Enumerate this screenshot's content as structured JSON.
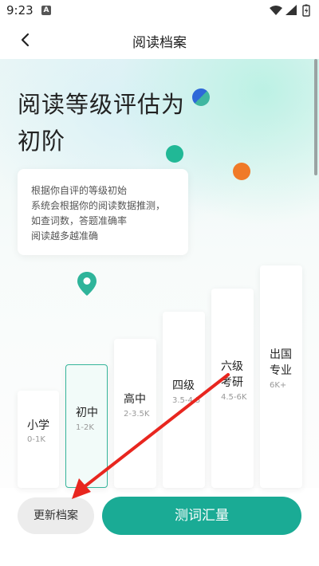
{
  "status_bar": {
    "time": "9:23",
    "notification_letter": "A"
  },
  "header": {
    "title": "阅读档案"
  },
  "main": {
    "headline_lines": [
      "阅读等级评估为",
      "初阶"
    ],
    "info_lines": [
      "根据你自评的等级初始",
      "系统会根据你的阅读数据推测，",
      "如查词数，答题准确率",
      "阅读越多越准确"
    ],
    "levels": [
      {
        "name_lines": [
          "小学"
        ],
        "range": "0-1K",
        "selected": false
      },
      {
        "name_lines": [
          "初中"
        ],
        "range": "1-2K",
        "selected": true
      },
      {
        "name_lines": [
          "高中"
        ],
        "range": "2-3.5K",
        "selected": false
      },
      {
        "name_lines": [
          "四级"
        ],
        "range": "3.5-4.5",
        "selected": false
      },
      {
        "name_lines": [
          "六级",
          "考研"
        ],
        "range": "4.5-6K",
        "selected": false
      },
      {
        "name_lines": [
          "出国",
          "专业"
        ],
        "range": "6K+",
        "selected": false
      }
    ]
  },
  "actions": {
    "update_label": "更新档案",
    "test_label": "测词汇量"
  },
  "colors": {
    "accent": "#1aab95",
    "dot_blue": "#2e68d8",
    "dot_teal": "#21b896",
    "dot_orange": "#f07a28",
    "annotation_arrow": "#e8261f"
  },
  "icons": [
    "back-chevron-icon",
    "wifi-icon",
    "signal-icon",
    "battery-icon",
    "location-pin-icon"
  ]
}
